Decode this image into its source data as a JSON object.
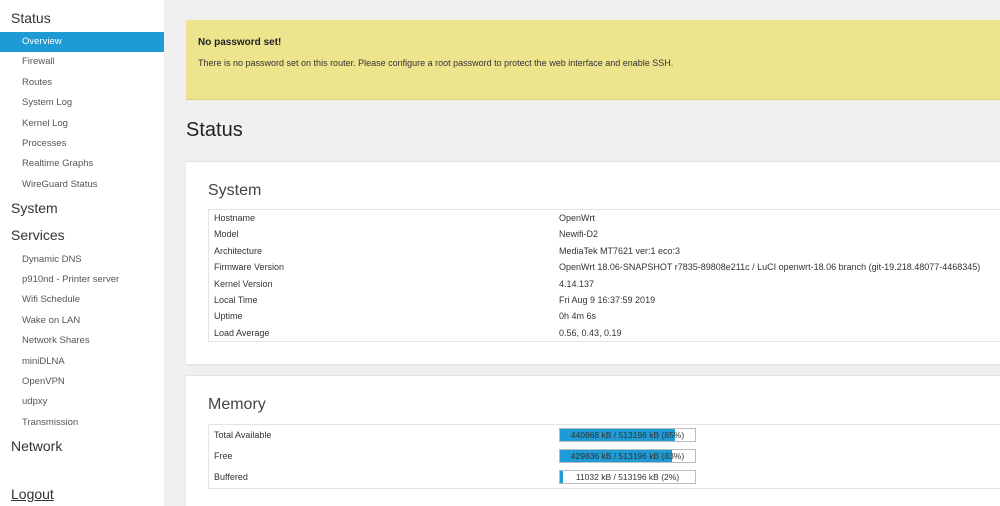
{
  "sidebar": {
    "status_label": "Status",
    "status_items": [
      {
        "label": "Overview"
      },
      {
        "label": "Firewall"
      },
      {
        "label": "Routes"
      },
      {
        "label": "System Log"
      },
      {
        "label": "Kernel Log"
      },
      {
        "label": "Processes"
      },
      {
        "label": "Realtime Graphs"
      },
      {
        "label": "WireGuard Status"
      }
    ],
    "system_label": "System",
    "services_label": "Services",
    "services_items": [
      {
        "label": "Dynamic DNS"
      },
      {
        "label": "p910nd - Printer server"
      },
      {
        "label": "Wifi Schedule"
      },
      {
        "label": "Wake on LAN"
      },
      {
        "label": "Network Shares"
      },
      {
        "label": "miniDLNA"
      },
      {
        "label": "OpenVPN"
      },
      {
        "label": "udpxy"
      },
      {
        "label": "Transmission"
      }
    ],
    "network_label": "Network",
    "logout_label": "Logout"
  },
  "alert": {
    "title": "No password set!",
    "message": "There is no password set on this router. Please configure a root password to protect the web interface and enable SSH."
  },
  "page_title": "Status",
  "system": {
    "title": "System",
    "rows": [
      {
        "key": "Hostname",
        "value": "OpenWrt"
      },
      {
        "key": "Model",
        "value": "Newifi-D2"
      },
      {
        "key": "Architecture",
        "value": "MediaTek MT7621 ver:1 eco:3"
      },
      {
        "key": "Firmware Version",
        "value": "OpenWrt 18.06-SNAPSHOT r7835-89808e211c / LuCI openwrt-18.06 branch (git-19.218.48077-4468345)"
      },
      {
        "key": "Kernel Version",
        "value": "4.14.137"
      },
      {
        "key": "Local Time",
        "value": "Fri Aug 9 16:37:59 2019"
      },
      {
        "key": "Uptime",
        "value": "0h 4m 6s"
      },
      {
        "key": "Load Average",
        "value": "0.56, 0.43, 0.19"
      }
    ]
  },
  "memory": {
    "title": "Memory",
    "rows": [
      {
        "key": "Total Available",
        "text": "440868 kB / 513196 kB (85%)",
        "percent": 85
      },
      {
        "key": "Free",
        "text": "429836 kB / 513196 kB (83%)",
        "percent": 83
      },
      {
        "key": "Buffered",
        "text": "11032 kB / 513196 kB (2%)",
        "percent": 2
      }
    ]
  },
  "colors": {
    "accent": "#1e9ad4",
    "alert_bg": "#ede58e"
  }
}
